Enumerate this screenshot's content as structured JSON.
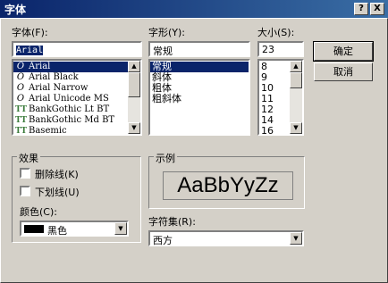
{
  "window": {
    "title": "字体",
    "help_glyph": "?",
    "close_glyph": "X"
  },
  "font": {
    "label": "字体(F):",
    "value": "Arial",
    "items": [
      {
        "icon": "O",
        "name": "Arial"
      },
      {
        "icon": "O",
        "name": "Arial Black"
      },
      {
        "icon": "O",
        "name": "Arial Narrow"
      },
      {
        "icon": "O",
        "name": "Arial Unicode MS"
      },
      {
        "icon": "TT",
        "name": "BankGothic Lt BT"
      },
      {
        "icon": "TT",
        "name": "BankGothic Md BT"
      },
      {
        "icon": "TT",
        "name": "Basemic"
      }
    ]
  },
  "style": {
    "label": "字形(Y):",
    "value": "常规",
    "items": [
      "常规",
      "斜体",
      "粗体",
      "粗斜体"
    ]
  },
  "size": {
    "label": "大小(S):",
    "value": "23",
    "items": [
      "8",
      "9",
      "10",
      "11",
      "12",
      "14",
      "16"
    ]
  },
  "buttons": {
    "ok": "确定",
    "cancel": "取消"
  },
  "effects": {
    "label": "效果",
    "strike": "删除线(K)",
    "underline": "下划线(U)",
    "color_label": "颜色(C):",
    "color_value": "黑色",
    "color_swatch": "#000000"
  },
  "sample": {
    "label": "示例",
    "text": "AaBbYyZz"
  },
  "script": {
    "label": "字符集(R):",
    "value": "西方"
  }
}
